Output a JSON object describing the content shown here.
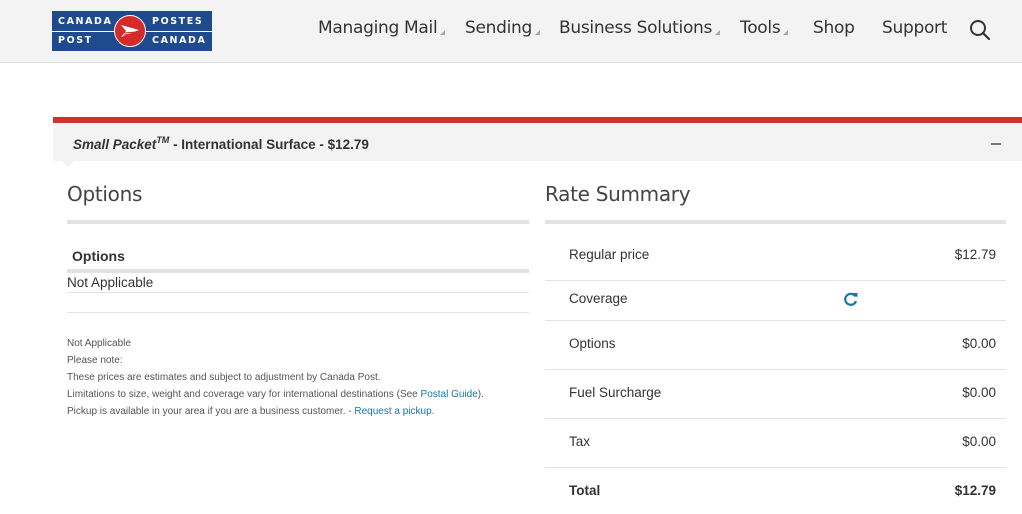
{
  "header": {
    "logo": {
      "top_left": "CANADA",
      "top_right": "POSTES",
      "bottom_left": "POST",
      "bottom_right": "CANADA"
    },
    "nav": [
      {
        "label": "Managing Mail",
        "has_dropdown": true
      },
      {
        "label": "Sending",
        "has_dropdown": true
      },
      {
        "label": "Business Solutions",
        "has_dropdown": true
      },
      {
        "label": "Tools",
        "has_dropdown": true
      },
      {
        "label": "Shop",
        "has_dropdown": false
      },
      {
        "label": "Support",
        "has_dropdown": false
      }
    ],
    "search_icon": "search-icon"
  },
  "panel": {
    "product_name": "Small Packet",
    "trademark": "TM",
    "title_rest": " - International Surface - $12.79",
    "collapse_icon": "minus-icon",
    "accent_color": "#d0312d"
  },
  "options": {
    "title": "Options",
    "table_header": "Options",
    "value": "Not Applicable",
    "notes": {
      "line1": "Not Applicable",
      "line2": "Please note:",
      "line3": "These prices are estimates and subject to adjustment by Canada Post.",
      "line4_pre": "Limitations to size, weight and coverage vary for international destinations (See ",
      "line4_link": "Postal Guide",
      "line4_post": ").",
      "line5_pre": "Pickup is available in your area if you are a business customer. - ",
      "line5_link": "Request a pickup."
    }
  },
  "rate_summary": {
    "title": "Rate Summary",
    "rows": [
      {
        "label": "Regular price",
        "value": "$12.79"
      },
      {
        "label": "Coverage",
        "value": "",
        "icon": "refresh-icon"
      },
      {
        "label": "Options",
        "value": "$0.00"
      },
      {
        "label": "Fuel Surcharge",
        "value": "$0.00"
      },
      {
        "label": "Tax",
        "value": "$0.00"
      },
      {
        "label": "Total",
        "value": "$12.79"
      }
    ],
    "link_color": "#1a75a8"
  }
}
